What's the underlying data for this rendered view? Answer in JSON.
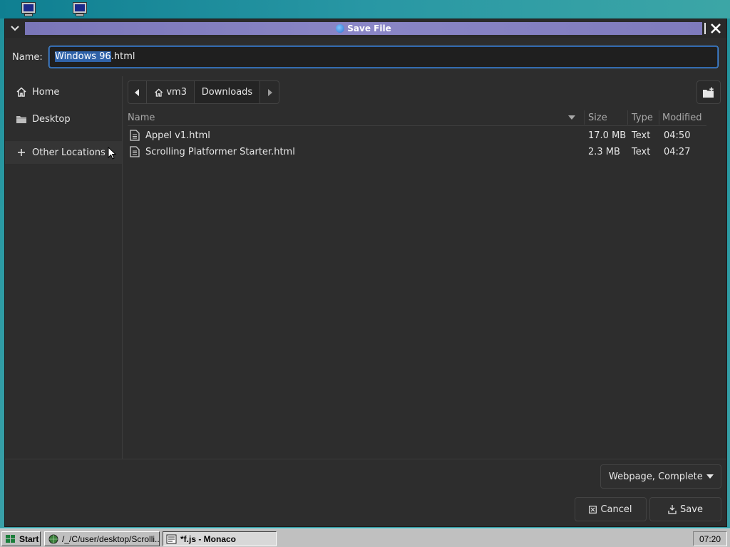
{
  "desktop": {
    "icons": [
      "computer-icon",
      "monitor-icon"
    ]
  },
  "dialog": {
    "title": "Save File",
    "name_label": "Name:",
    "filename_selected": "Windows 96",
    "filename_rest": ".html"
  },
  "sidebar": {
    "items": [
      {
        "label": "Home",
        "icon": "home-icon"
      },
      {
        "label": "Desktop",
        "icon": "folder-icon"
      },
      {
        "label": "Other Locations",
        "icon": "plus-icon"
      }
    ]
  },
  "pathbar": {
    "segments": [
      "vm3",
      "Downloads"
    ]
  },
  "columns": {
    "name": "Name",
    "size": "Size",
    "type": "Type",
    "modified": "Modified"
  },
  "files": [
    {
      "name": "Appel v1.html",
      "size": "17.0 MB",
      "type": "Text",
      "modified": "04:50"
    },
    {
      "name": "Scrolling Platformer Starter.html",
      "size": "2.3 MB",
      "type": "Text",
      "modified": "04:27"
    }
  ],
  "filter": {
    "selected": "Webpage, Complete"
  },
  "buttons": {
    "cancel": "Cancel",
    "save": "Save"
  },
  "taskbar": {
    "start": "Start",
    "tasks": [
      {
        "label": "/_/C/user/desktop/Scrolli..."
      },
      {
        "label": "*f.js - Monaco"
      }
    ],
    "clock": "07:20"
  }
}
